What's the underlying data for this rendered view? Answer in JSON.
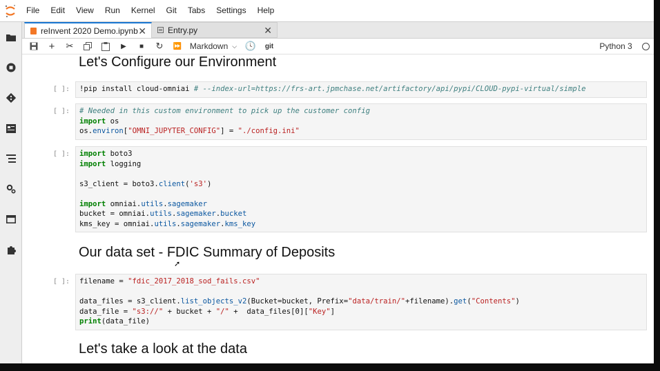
{
  "menubar": {
    "items": [
      "File",
      "Edit",
      "View",
      "Run",
      "Kernel",
      "Git",
      "Tabs",
      "Settings",
      "Help"
    ]
  },
  "sidebar": {
    "icons": [
      "folder-icon",
      "running-icon",
      "git-icon",
      "property-inspector-icon",
      "table-of-contents-icon",
      "extension-settings-icon",
      "tabs-icon",
      "extension-manager-icon"
    ]
  },
  "tabs": [
    {
      "label": "reInvent 2020 Demo.ipynb",
      "active": true
    },
    {
      "label": "Entry.py",
      "active": false
    }
  ],
  "toolbar": {
    "cell_type": "Markdown",
    "git_label": "git",
    "kernel": "Python 3"
  },
  "cells": [
    {
      "kind": "heading",
      "text": "Let's Configure our Environment"
    },
    {
      "kind": "code",
      "prompt": "[ ]:",
      "lines": [
        [
          {
            "t": "!pip install cloud-omniai ",
            "c": ""
          },
          {
            "t": "# --index-url=https://frs-art.jpmchase.net/artifactory/api/pypi/CLOUD-pypi-virtual/simple",
            "c": "cm"
          }
        ]
      ]
    },
    {
      "kind": "code",
      "prompt": "[ ]:",
      "lines": [
        [
          {
            "t": "# Needed in this custom environment to pick up the customer config",
            "c": "cm"
          }
        ],
        [
          {
            "t": "import",
            "c": "kw"
          },
          {
            "t": " os",
            "c": ""
          }
        ],
        [
          {
            "t": "os.",
            "c": ""
          },
          {
            "t": "environ",
            "c": "attr"
          },
          {
            "t": "[",
            "c": ""
          },
          {
            "t": "\"OMNI_JUPYTER_CONFIG\"",
            "c": "str"
          },
          {
            "t": "] = ",
            "c": ""
          },
          {
            "t": "\"./config.ini\"",
            "c": "str"
          }
        ]
      ]
    },
    {
      "kind": "code",
      "prompt": "[ ]:",
      "lines": [
        [
          {
            "t": "import",
            "c": "kw"
          },
          {
            "t": " boto3",
            "c": ""
          }
        ],
        [
          {
            "t": "import",
            "c": "kw"
          },
          {
            "t": " logging",
            "c": ""
          }
        ],
        [],
        [
          {
            "t": "s3_client = boto3.",
            "c": ""
          },
          {
            "t": "client",
            "c": "attr"
          },
          {
            "t": "(",
            "c": ""
          },
          {
            "t": "'s3'",
            "c": "str"
          },
          {
            "t": ")",
            "c": ""
          }
        ],
        [],
        [
          {
            "t": "import",
            "c": "kw"
          },
          {
            "t": " omniai.",
            "c": ""
          },
          {
            "t": "utils",
            "c": "attr"
          },
          {
            "t": ".",
            "c": ""
          },
          {
            "t": "sagemaker",
            "c": "attr"
          }
        ],
        [
          {
            "t": "bucket = omniai.",
            "c": ""
          },
          {
            "t": "utils",
            "c": "attr"
          },
          {
            "t": ".",
            "c": ""
          },
          {
            "t": "sagemaker",
            "c": "attr"
          },
          {
            "t": ".",
            "c": ""
          },
          {
            "t": "bucket",
            "c": "attr"
          }
        ],
        [
          {
            "t": "kms_key = omniai.",
            "c": ""
          },
          {
            "t": "utils",
            "c": "attr"
          },
          {
            "t": ".",
            "c": ""
          },
          {
            "t": "sagemaker",
            "c": "attr"
          },
          {
            "t": ".",
            "c": ""
          },
          {
            "t": "kms_key",
            "c": "attr"
          }
        ]
      ]
    },
    {
      "kind": "heading",
      "text": "Our data set - FDIC Summary of Deposits"
    },
    {
      "kind": "code",
      "prompt": "[ ]:",
      "lines": [
        [
          {
            "t": "filename = ",
            "c": ""
          },
          {
            "t": "\"fdic_2017_2018_sod_fails.csv\"",
            "c": "str"
          }
        ],
        [],
        [
          {
            "t": "data_files = s3_client.",
            "c": ""
          },
          {
            "t": "list_objects_v2",
            "c": "attr"
          },
          {
            "t": "(Bucket=bucket, Prefix=",
            "c": ""
          },
          {
            "t": "\"data/train/\"",
            "c": "str"
          },
          {
            "t": "+filename).",
            "c": ""
          },
          {
            "t": "get",
            "c": "attr"
          },
          {
            "t": "(",
            "c": ""
          },
          {
            "t": "\"Contents\"",
            "c": "str"
          },
          {
            "t": ")",
            "c": ""
          }
        ],
        [
          {
            "t": "data_file = ",
            "c": ""
          },
          {
            "t": "\"s3://\"",
            "c": "str"
          },
          {
            "t": " + bucket + ",
            "c": ""
          },
          {
            "t": "\"/\"",
            "c": "str"
          },
          {
            "t": " +  data_files[0][",
            "c": ""
          },
          {
            "t": "\"Key\"",
            "c": "str"
          },
          {
            "t": "]",
            "c": ""
          }
        ],
        [
          {
            "t": "print",
            "c": "kw"
          },
          {
            "t": "(data_file)",
            "c": ""
          }
        ]
      ]
    },
    {
      "kind": "heading",
      "text": "Let's take a look at the data"
    }
  ]
}
